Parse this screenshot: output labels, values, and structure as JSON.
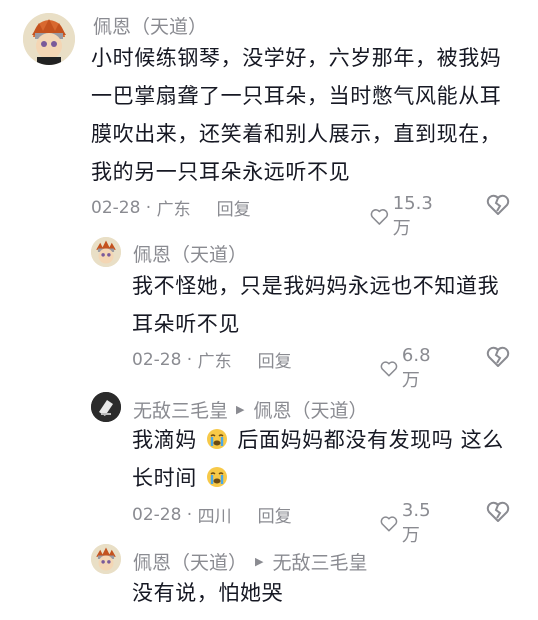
{
  "comments": [
    {
      "author": "佩恩（天道）",
      "reply_to": "",
      "lines": [
        "小时候练钢琴，没学好，六岁那年，被我妈",
        "一巴掌扇聋了一只耳朵，当时憋气风能从耳",
        "膜吹出来，还笑着和别人展示，直到现在，",
        "我的另一只耳朵永远听不见"
      ],
      "date": "02-28",
      "location": "广东",
      "reply_label": "回复",
      "likes": "15.3万"
    },
    {
      "author": "佩恩（天道）",
      "reply_to": "",
      "lines": [
        "我不怪她，只是我妈妈永远也不知道我",
        "耳朵听不见"
      ],
      "date": "02-28",
      "location": "广东",
      "reply_label": "回复",
      "likes": "6.8万"
    },
    {
      "author": "无敌三毛皇",
      "reply_to": "佩恩（天道）",
      "lines_a": [
        "我滴妈",
        "后面妈妈都没有发现吗 这么"
      ],
      "lines_b": [
        "长时间"
      ],
      "date": "02-28",
      "location": "四川",
      "reply_label": "回复",
      "likes": "3.5万"
    },
    {
      "author": "佩恩（天道）",
      "reply_to": "无敌三毛皇",
      "lines": [
        "没有说，怕她哭"
      ]
    }
  ],
  "colors": {
    "text": "#161823",
    "muted": "#8a8b91"
  },
  "icons": {
    "like": "heart-outline-icon",
    "dislike": "broken-heart-icon",
    "reply_arrow": "triangle-right-icon",
    "emoji": "crying-face-emoji"
  }
}
